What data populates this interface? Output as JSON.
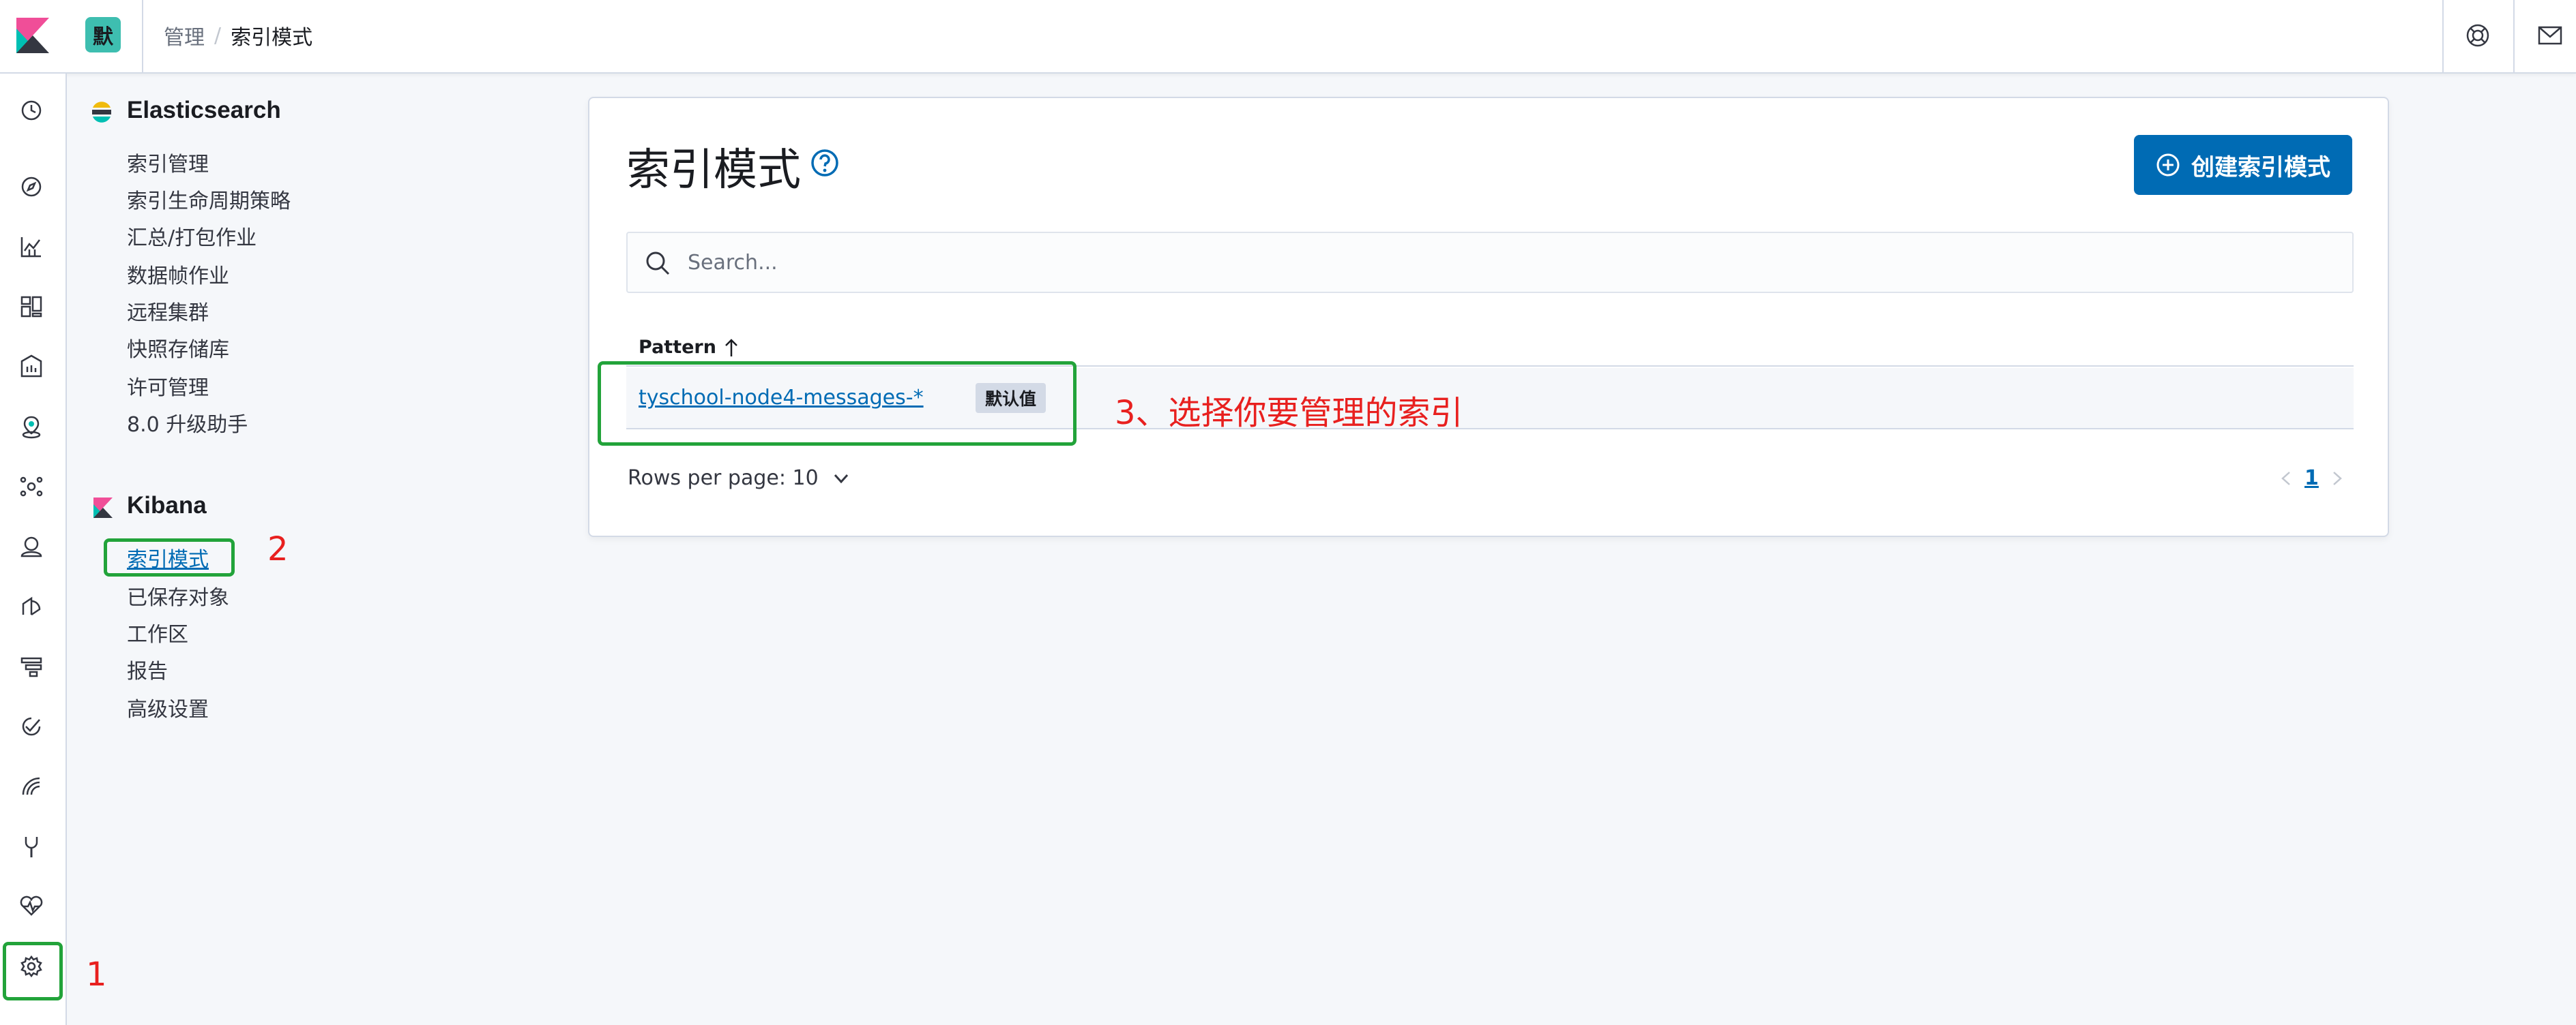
{
  "header": {
    "space_initial": "默",
    "breadcrumbs": [
      "管理",
      "索引模式"
    ],
    "separator": "/"
  },
  "left_nav": {
    "icons": [
      "clock-icon",
      "compass-icon",
      "visualize-icon",
      "dashboard-icon",
      "canvas-icon",
      "maps-icon",
      "ml-icon",
      "metrics-icon",
      "logs-icon",
      "apm-icon",
      "uptime-icon",
      "siem-icon",
      "dev-tools-icon",
      "monitoring-icon",
      "management-gear-icon"
    ]
  },
  "sidebar": {
    "elasticsearch": {
      "title": "Elasticsearch",
      "items": [
        "索引管理",
        "索引生命周期策略",
        "汇总/打包作业",
        "数据帧作业",
        "远程集群",
        "快照存储库",
        "许可管理",
        "8.0 升级助手"
      ]
    },
    "kibana": {
      "title": "Kibana",
      "items": [
        "索引模式",
        "已保存对象",
        "工作区",
        "报告",
        "高级设置"
      ],
      "active_index": 0
    }
  },
  "main": {
    "title": "索引模式",
    "create_button": "创建索引模式",
    "search_placeholder": "Search...",
    "table": {
      "column": "Pattern",
      "rows": [
        {
          "pattern": "tyschool-node4-messages-*",
          "badge": "默认值"
        }
      ]
    },
    "rows_per_page": "Rows per page: 10",
    "current_page": "1"
  },
  "annotations": {
    "step1": "1",
    "step2": "2",
    "step3": "3、选择你要管理的索引"
  },
  "colors": {
    "accent": "#006bb4",
    "space_badge": "#3ebeb0",
    "annotation_box": "#22a33a",
    "annotation_text": "#e8201f"
  }
}
